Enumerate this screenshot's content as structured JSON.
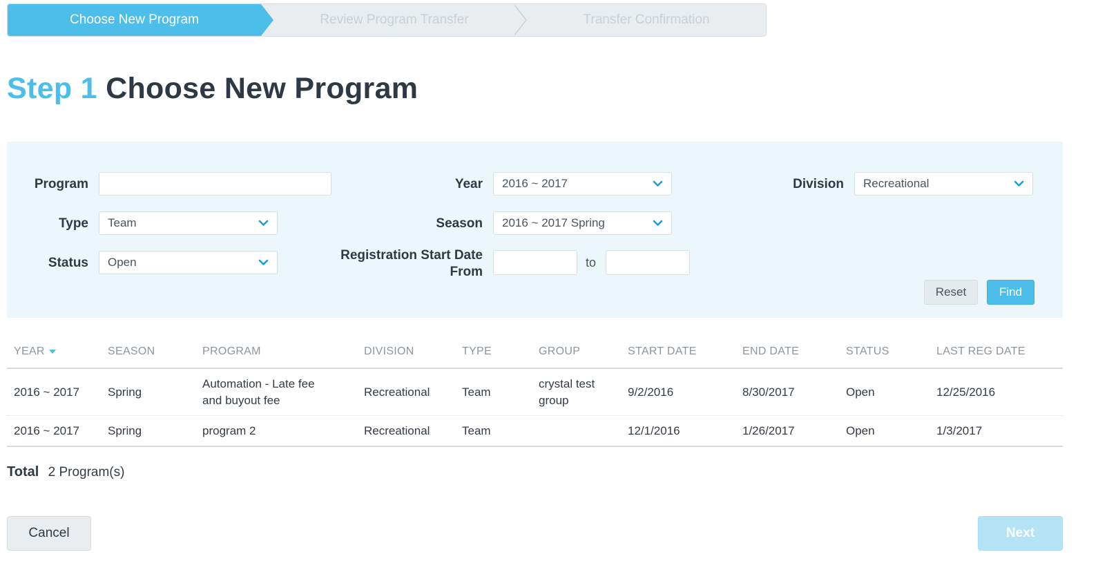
{
  "stepper": {
    "steps": [
      {
        "label": "Choose New Program",
        "active": true
      },
      {
        "label": "Review Program Transfer",
        "active": false
      },
      {
        "label": "Transfer Confirmation",
        "active": false
      }
    ]
  },
  "heading": {
    "step_label": "Step 1",
    "title": "Choose New Program"
  },
  "filters": {
    "program": {
      "label": "Program",
      "value": ""
    },
    "year": {
      "label": "Year",
      "value": "2016 ~ 2017",
      "icon": "chevron-down-icon"
    },
    "division": {
      "label": "Division",
      "value": "Recreational",
      "icon": "chevron-down-icon"
    },
    "type": {
      "label": "Type",
      "value": "Team",
      "icon": "chevron-down-icon"
    },
    "season": {
      "label": "Season",
      "value": "2016 ~ 2017 Spring",
      "icon": "chevron-down-icon"
    },
    "status": {
      "label": "Status",
      "value": "Open",
      "icon": "chevron-down-icon"
    },
    "reg_start": {
      "label_line1": "Registration Start Date",
      "label_line2": "From",
      "from_value": "",
      "to_label": "to",
      "to_value": ""
    },
    "reset_label": "Reset",
    "find_label": "Find"
  },
  "table": {
    "columns": [
      "YEAR",
      "SEASON",
      "PROGRAM",
      "DIVISION",
      "TYPE",
      "GROUP",
      "START DATE",
      "END DATE",
      "STATUS",
      "LAST REG DATE"
    ],
    "sort_icon": "sort-down-icon",
    "rows": [
      {
        "year": "2016 ~ 2017",
        "season": "Spring",
        "program_line1": "Automation - Late fee",
        "program_line2": "and buyout fee",
        "division": "Recreational",
        "type": "Team",
        "group_line1": "crystal test",
        "group_line2": "group",
        "start_date": "9/2/2016",
        "end_date": "8/30/2017",
        "status": "Open",
        "last_reg_date": "12/25/2016"
      },
      {
        "year": "2016 ~ 2017",
        "season": "Spring",
        "program_line1": "program 2",
        "program_line2": "",
        "division": "Recreational",
        "type": "Team",
        "group_line1": "",
        "group_line2": "",
        "start_date": "12/1/2016",
        "end_date": "1/26/2017",
        "status": "Open",
        "last_reg_date": "1/3/2017"
      }
    ]
  },
  "total": {
    "label": "Total",
    "count": "2",
    "unit": "Program(s)"
  },
  "footer": {
    "cancel_label": "Cancel",
    "next_label": "Next"
  },
  "colors": {
    "accent": "#4dbde9",
    "panel_bg": "#ecf7fb",
    "heading": "#2d3a45"
  }
}
